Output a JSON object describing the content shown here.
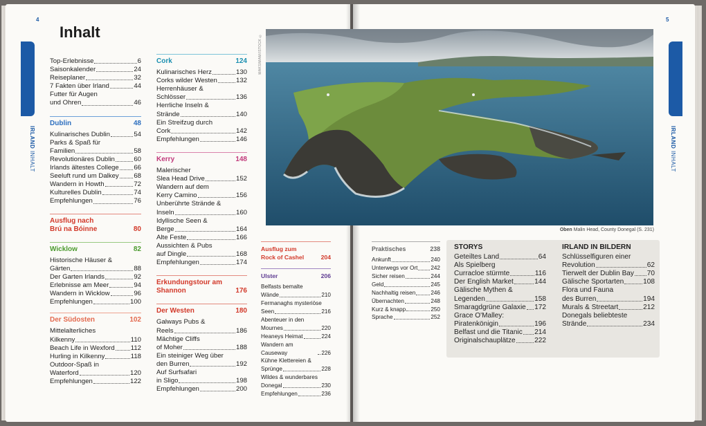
{
  "pages": {
    "left_number": "4",
    "right_number": "5"
  },
  "side_label": {
    "strong": "IRLAND",
    "light": "INHALT"
  },
  "title": "Inhalt",
  "col1": {
    "intro": [
      {
        "t": "Top-Erlebnisse",
        "n": "6"
      },
      {
        "t": "Saisonkalender",
        "n": "24"
      },
      {
        "t": "Reiseplaner",
        "n": "32"
      },
      {
        "t": "7 Fakten über Irland",
        "n": "44"
      },
      {
        "t1": "Futter für Augen",
        "t": "und Ohren",
        "n": "46"
      }
    ],
    "dublin": {
      "title": "Dublin",
      "page": "48",
      "items": [
        {
          "t": "Kulinarisches Dublin",
          "n": "54"
        },
        {
          "t1": "Parks & Spaß für",
          "t": "Familien",
          "n": "58"
        },
        {
          "t": "Revolutionäres Dublin",
          "n": "60"
        },
        {
          "t": "Irlands ältestes College",
          "n": "66"
        },
        {
          "t": "Seeluft rund um Dalkey",
          "n": "68"
        },
        {
          "t": "Wandern in Howth",
          "n": "72"
        },
        {
          "t": "Kulturelles Dublin",
          "n": "74"
        },
        {
          "t": "Empfehlungen",
          "n": "76"
        }
      ]
    },
    "ausflug": {
      "line1": "Ausflug nach",
      "line2": "Brú na Bóinne",
      "page": "80"
    },
    "wicklow": {
      "title": "Wicklow",
      "page": "82",
      "items": [
        {
          "t1": "Historische Häuser &",
          "t": "Gärten",
          "n": "88"
        },
        {
          "t": "Der Garten Irlands",
          "n": "92"
        },
        {
          "t": "Erlebnisse am Meer",
          "n": "94"
        },
        {
          "t": "Wandern in Wicklow",
          "n": "96"
        },
        {
          "t": "Empfehlungen",
          "n": "100"
        }
      ]
    },
    "suedosten": {
      "title": "Der Südosten",
      "page": "102",
      "items": [
        {
          "t1": "Mittelalterliches",
          "t": "Kilkenny",
          "n": "110"
        },
        {
          "t": "Beach Life in Wexford",
          "n": "112"
        },
        {
          "t": "Hurling in Kilkenny",
          "n": "118"
        },
        {
          "t1": "Outdoor-Spaß in",
          "t": "Waterford",
          "n": "120"
        },
        {
          "t": "Empfehlungen",
          "n": "122"
        }
      ]
    }
  },
  "col2": {
    "cork": {
      "title": "Cork",
      "page": "124",
      "items": [
        {
          "t": "Kulinarisches Herz",
          "n": "130"
        },
        {
          "t": "Corks wilder Westen",
          "n": "132"
        },
        {
          "t1": "Herrenhäuser &",
          "t": "Schlösser",
          "n": "136"
        },
        {
          "t1": "Herrliche Inseln &",
          "t": "Strände",
          "n": "140"
        },
        {
          "t1": "Ein Streifzug durch",
          "t": "Cork",
          "n": "142"
        },
        {
          "t": "Empfehlungen",
          "n": "146"
        }
      ]
    },
    "kerry": {
      "title": "Kerry",
      "page": "148",
      "items": [
        {
          "t1": "Malerischer",
          "t": "Slea Head Drive",
          "n": "152"
        },
        {
          "t1": "Wandern auf dem",
          "t": "Kerry Camino",
          "n": "156"
        },
        {
          "t1": "Unberührte Strände &",
          "t": "Inseln",
          "n": "160"
        },
        {
          "t1": "Idyllische Seen &",
          "t": "Berge",
          "n": "164"
        },
        {
          "t": "Alte Feste",
          "n": "166"
        },
        {
          "t1": "Aussichten & Pubs",
          "t": "auf Dingle",
          "n": "168"
        },
        {
          "t": "Empfehlungen",
          "n": "174"
        }
      ]
    },
    "erkundung": {
      "line1": "Erkundungstour am",
      "line2": "Shannon",
      "page": "176"
    },
    "westen": {
      "title": "Der Westen",
      "page": "180",
      "items": [
        {
          "t1": "Galways Pubs &",
          "t": "Reels",
          "n": "186"
        },
        {
          "t1": "Mächtige Cliffs",
          "t": "of Moher",
          "n": "188"
        },
        {
          "t1": "Ein steiniger Weg über",
          "t": "den Burren",
          "n": "192"
        },
        {
          "t1": "Auf Surfsafari",
          "t": "in Sligo",
          "n": "198"
        },
        {
          "t": "Empfehlungen",
          "n": "200"
        }
      ]
    }
  },
  "col3": {
    "ausflug": {
      "line1": "Ausflug zum",
      "line2": "Rock of Cashel",
      "page": "204"
    },
    "ulster": {
      "title": "Ulster",
      "page": "206",
      "items": [
        {
          "t1": "Belfasts bemalte",
          "t": "Wände",
          "n": "210"
        },
        {
          "t1": "Fermanaghs mysteriöse",
          "t": "Seen",
          "n": "216"
        },
        {
          "t1": "Abenteuer in den",
          "t": "Mournes",
          "n": "220"
        },
        {
          "t": "Heaneys Heimat",
          "n": "224"
        },
        {
          "t": "Wandern am Causeway",
          "n": "226"
        },
        {
          "t1": "Kühne Klettereien &",
          "t": "Sprünge",
          "n": "228"
        },
        {
          "t1": "Wildes & wunderbares",
          "t": "Donegal",
          "n": "230"
        },
        {
          "t": "Empfehlungen",
          "n": "236"
        }
      ]
    }
  },
  "col4": {
    "title": "Praktisches",
    "page": "238",
    "items": [
      {
        "t": "Ankunft",
        "n": "240"
      },
      {
        "t": "Unterwegs vor Ort",
        "n": "242"
      },
      {
        "t": "Sicher reisen",
        "n": "244"
      },
      {
        "t": "Geld",
        "n": "245"
      },
      {
        "t": "Nachhaltig reisen",
        "n": "246"
      },
      {
        "t": "Übernachten",
        "n": "248"
      },
      {
        "t": "Kurz & knapp",
        "n": "250"
      },
      {
        "t": "Sprache",
        "n": "252"
      }
    ]
  },
  "storys": {
    "title": "STORYS",
    "items": [
      {
        "t": "Geteiltes Land",
        "n": "64"
      },
      {
        "t1": "Als Spielberg",
        "t": "Curracloe stürmte",
        "n": "116"
      },
      {
        "t": "Der English Market",
        "n": "144"
      },
      {
        "t1": "Gälische Mythen &",
        "t": "Legenden",
        "n": "158"
      },
      {
        "t": "Smaragdgrüne Galaxie",
        "n": "172"
      },
      {
        "t1": "Grace O'Malley:",
        "t": "Piratenkönigin",
        "n": "196"
      },
      {
        "t": "Belfast und die Titanic",
        "n": "214"
      },
      {
        "t": "Originalschauplätze",
        "n": "222"
      }
    ]
  },
  "bildern": {
    "title": "IRLAND IN BILDERN",
    "items": [
      {
        "t1": "Schlüsselfiguren einer",
        "t": "Revolution",
        "n": "62"
      },
      {
        "t": "Tierwelt der Dublin Bay",
        "n": "70"
      },
      {
        "t": "Gälische Sportarten",
        "n": "108"
      },
      {
        "t1": "Flora und Fauna",
        "t": "des Burren",
        "n": "194"
      },
      {
        "t": "Murals & Streetart",
        "n": "212"
      },
      {
        "t1": "Donegals beliebteste",
        "t": "Strände",
        "n": "234"
      }
    ]
  },
  "photo": {
    "credit": "MAKSIMAM/ISTOCK ©",
    "caption_bold": "Oben",
    "caption": "Malin Head, County Donegal (S. 231)"
  },
  "colors": {
    "brand_blue": "#1c5aa6",
    "dublin": "#2d6fbf",
    "cork": "#1b8fb0",
    "kerry": "#c0397a",
    "ausflug": "#d2392a",
    "wicklow": "#4b9a2e",
    "suedosten": "#e36a4f",
    "westen": "#d2392a",
    "ulster": "#5e3b91"
  }
}
